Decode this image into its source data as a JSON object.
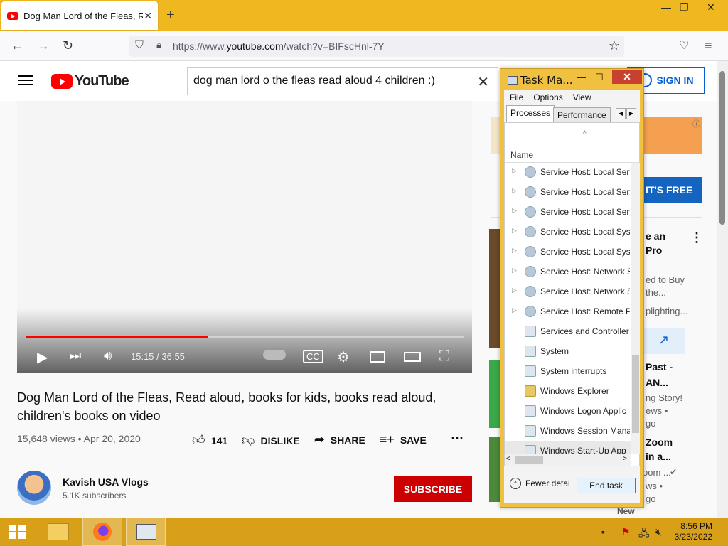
{
  "browser": {
    "tab_title": "Dog Man Lord of the Fleas, Rea",
    "tab_close": "✕",
    "new_tab": "+",
    "window_min": "—",
    "window_max": "❐",
    "window_close": "✕",
    "url_prefix": "https://www.",
    "url_domain": "youtube.com",
    "url_path": "/watch?v=BIFscHnl-7Y"
  },
  "youtube": {
    "logo_text": "YouTube",
    "search_value": "dog man lord o the fleas read aloud 4 children :)",
    "clear": "✕",
    "signin": "SIGN IN",
    "time": "15:15 / 36:55",
    "progress_fraction": 0.415,
    "video_title": "Dog Man Lord of the Fleas, Read aloud, books for kids, books read aloud, children's books on video",
    "views_date": "15,648 views • Apr 20, 2020",
    "likes": "141",
    "dislike": "DISLIKE",
    "share": "SHARE",
    "save": "SAVE",
    "more": "⋯",
    "channel_name": "Kavish USA Vlogs",
    "channel_subs": "5.1K subscribers",
    "subscribe": "SUBSCRIBE"
  },
  "sidebar_fragments": {
    "try_free": "IT'S FREE",
    "r1a": "e an",
    "r1b": "Pro",
    "r1c": "ed to Buy",
    "r1d": "the...",
    "r1e": "plighting...",
    "r2a": "Past -",
    "r2b": "AN...",
    "r2c": "ng Story!",
    "r2d": "ews •",
    "r2e": "go",
    "r3a": "Zoom",
    "r3b": "in a...",
    "r3c": "oom ...",
    "r3d": "ws •",
    "r3e": "go",
    "r3f": "New"
  },
  "task_manager": {
    "title": "Task Ma...",
    "min": "—",
    "max": "☐",
    "close": "✕",
    "menu": [
      "File",
      "Options",
      "View"
    ],
    "tabs": [
      "Processes",
      "Performance"
    ],
    "column": "Name",
    "rows": [
      {
        "name": "Service Host: Local Serv",
        "expand": true,
        "icon": "gear"
      },
      {
        "name": "Service Host: Local Serv",
        "expand": true,
        "icon": "gear"
      },
      {
        "name": "Service Host: Local Serv",
        "expand": true,
        "icon": "gear"
      },
      {
        "name": "Service Host: Local Syst",
        "expand": true,
        "icon": "gear"
      },
      {
        "name": "Service Host: Local Syst",
        "expand": true,
        "icon": "gear"
      },
      {
        "name": "Service Host: Network S",
        "expand": true,
        "icon": "gear"
      },
      {
        "name": "Service Host: Network S",
        "expand": true,
        "icon": "gear"
      },
      {
        "name": "Service Host: Remote P",
        "expand": true,
        "icon": "gear"
      },
      {
        "name": "Services and Controller",
        "expand": false,
        "icon": "window"
      },
      {
        "name": "System",
        "expand": false,
        "icon": "window"
      },
      {
        "name": "System interrupts",
        "expand": false,
        "icon": "window"
      },
      {
        "name": "Windows Explorer",
        "expand": false,
        "icon": "folder"
      },
      {
        "name": "Windows Logon Applic",
        "expand": false,
        "icon": "window"
      },
      {
        "name": "Windows Session Mana",
        "expand": false,
        "icon": "window"
      },
      {
        "name": "Windows Start-Up App",
        "expand": false,
        "icon": "window"
      }
    ],
    "fewer_details": "Fewer detai",
    "end_task": "End task"
  },
  "taskbar": {
    "time": "8:56 PM",
    "date": "3/23/2022"
  }
}
